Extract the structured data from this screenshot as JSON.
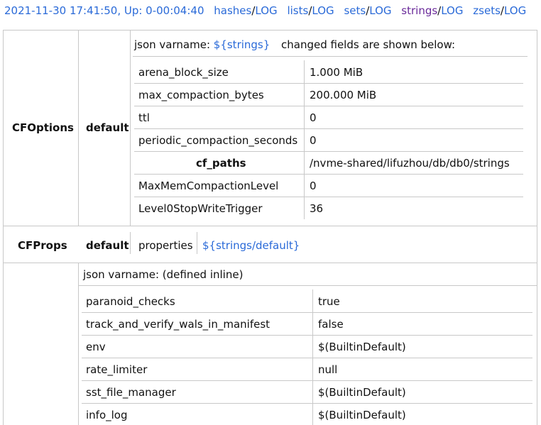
{
  "header": {
    "timestamp": "2021-11-30 17:41:50",
    "uptime_label": ", Up: 0-00:04:40",
    "nav": [
      {
        "name": "hashes",
        "log": "LOG"
      },
      {
        "name": "lists",
        "log": "LOG"
      },
      {
        "name": "sets",
        "log": "LOG"
      },
      {
        "name": "strings",
        "log": "LOG"
      },
      {
        "name": "zsets",
        "log": "LOG"
      }
    ],
    "slash": "/",
    "active_color": "#6a2a9a",
    "link_color": "#2a6ad8"
  },
  "cfoptions": {
    "section_label": "CFOptions",
    "cf_name": "default",
    "json_varname_label": "json varname:",
    "json_varname_value": "${strings}",
    "changed_note": "changed fields are shown below:",
    "rows": [
      {
        "key": "arena_block_size",
        "value": "1.000 MiB"
      },
      {
        "key": "max_compaction_bytes",
        "value": "200.000 MiB"
      },
      {
        "key": "ttl",
        "value": "0"
      },
      {
        "key": "periodic_compaction_seconds",
        "value": "0"
      },
      {
        "key": "cf_paths",
        "value": "/nvme-shared/lifuzhou/db/db0/strings"
      },
      {
        "key": "MaxMemCompactionLevel",
        "value": "0"
      },
      {
        "key": "Level0StopWriteTrigger",
        "value": "36"
      }
    ]
  },
  "cfprops": {
    "section_label": "CFProps",
    "cf_name": "default",
    "properties_label": "properties",
    "properties_link": "${strings/default}"
  },
  "dbopts": {
    "json_varname_text": "json varname: (defined inline)",
    "rows": [
      {
        "key": "paranoid_checks",
        "value": "true"
      },
      {
        "key": "track_and_verify_wals_in_manifest",
        "value": "false"
      },
      {
        "key": "env",
        "value": "$(BuiltinDefault)"
      },
      {
        "key": "rate_limiter",
        "value": "null"
      },
      {
        "key": "sst_file_manager",
        "value": "$(BuiltinDefault)"
      },
      {
        "key": "info_log",
        "value": "$(BuiltinDefault)"
      }
    ]
  }
}
